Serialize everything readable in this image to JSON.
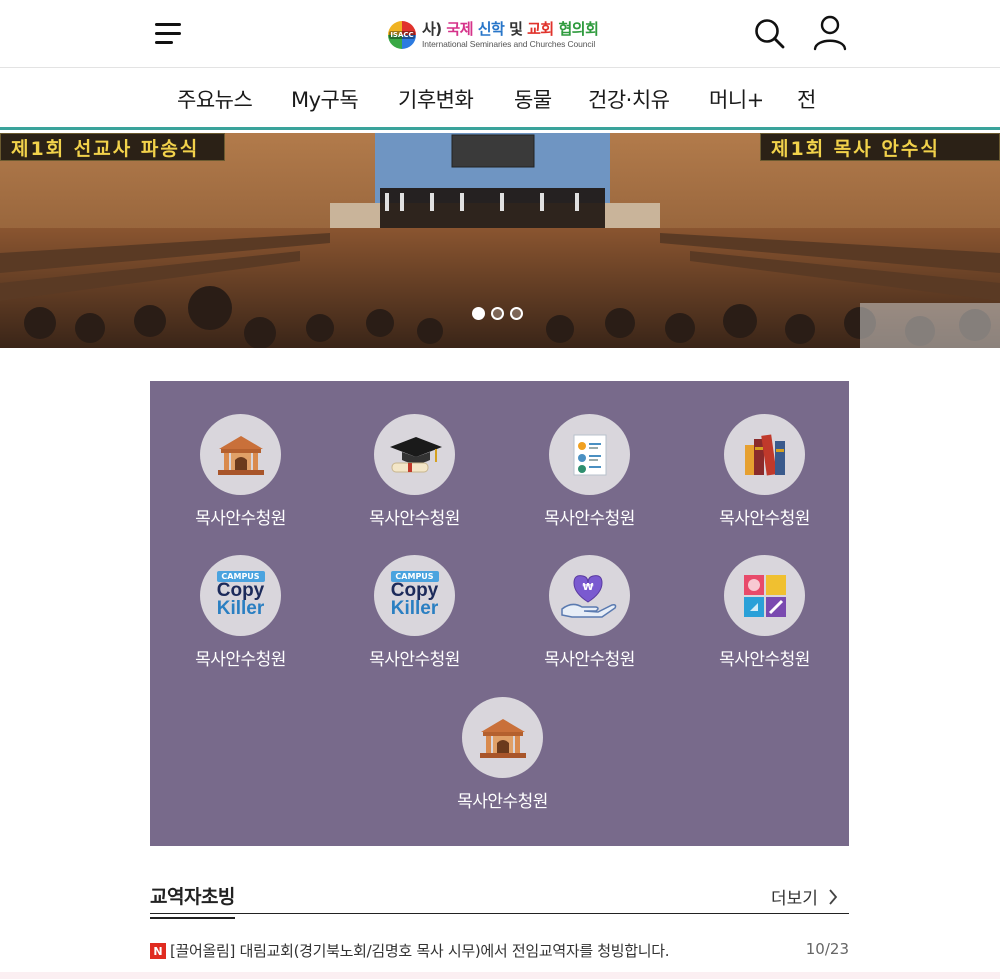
{
  "header": {
    "logo_mark": "ISACC",
    "logo_title": [
      "사)",
      "국제",
      "신학",
      "및",
      "교회",
      "협의회"
    ],
    "logo_subtitle": "International Seminaries and Churches Council"
  },
  "nav": {
    "tabs": [
      {
        "label": "주요뉴스"
      },
      {
        "label": "My구독"
      },
      {
        "label": "기후변화"
      },
      {
        "label": "동물"
      },
      {
        "label": "건강·치유"
      },
      {
        "label": "머니+"
      },
      {
        "label": "전"
      }
    ]
  },
  "banner": {
    "sign_left": "제1회 선교사 파송식",
    "sign_right": "제1회 목사 안수식",
    "slides": 3,
    "active_slide": 1
  },
  "services": {
    "items": [
      {
        "label": "목사안수청원",
        "icon": "building-icon"
      },
      {
        "label": "목사안수청원",
        "icon": "graduation-cap-icon"
      },
      {
        "label": "목사안수청원",
        "icon": "document-chart-icon"
      },
      {
        "label": "목사안수청원",
        "icon": "books-icon"
      },
      {
        "label": "목사안수청원",
        "icon": "copy-killer-icon"
      },
      {
        "label": "목사안수청원",
        "icon": "copy-killer-icon"
      },
      {
        "label": "목사안수청원",
        "icon": "donation-hand-icon"
      },
      {
        "label": "목사안수청원",
        "icon": "colorful-grid-icon"
      },
      {
        "label": "목사안수청원",
        "icon": "building-icon"
      }
    ],
    "copy_killer": {
      "campus": "CAMPUS",
      "copy": "Copy",
      "killer": "Killer"
    },
    "donation_symbol": "₩"
  },
  "section": {
    "title": "교역자초빙",
    "more_label": "더보기",
    "news": [
      {
        "badge": "N",
        "title": "[끌어올림] 대림교회(경기북노회/김명호 목사 시무)에서 전임교역자를 청빙합니다.",
        "date": "10/23"
      }
    ]
  },
  "colors": {
    "panel": "#786a8b",
    "nav_underline": "#3aa39b",
    "badge": "#e02b20"
  }
}
